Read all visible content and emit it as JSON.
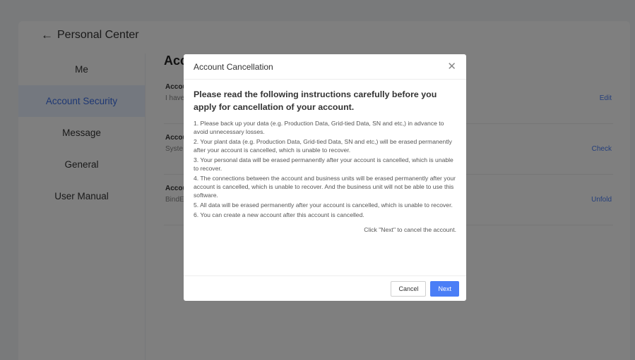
{
  "header": {
    "back_label": "Personal Center"
  },
  "sidebar": {
    "items": [
      {
        "label": "Me",
        "active": false
      },
      {
        "label": "Account Security",
        "active": true
      },
      {
        "label": "Message",
        "active": false
      },
      {
        "label": "General",
        "active": false
      },
      {
        "label": "User Manual",
        "active": false
      }
    ]
  },
  "main": {
    "title": "Acc",
    "rows": [
      {
        "label": "Accou",
        "sub": "I have",
        "action": "Edit"
      },
      {
        "label": "Accou",
        "sub": "Syste",
        "action": "Check"
      },
      {
        "label": "Accou",
        "sub": "BindE",
        "action": "Unfold"
      }
    ]
  },
  "modal": {
    "title": "Account Cancellation",
    "lead": "Please read the following instructions carefully before you apply for cancellation of your account.",
    "items": [
      "1. Please back up your data (e.g. Production Data, Grid-tied Data, SN and etc,) in advance to avoid unnecessary losses.",
      "2. Your plant data (e.g. Production Data, Grid-tied Data, SN and etc,) will be erased permanently after your account is cancelled, which is unable to recover.",
      "3. Your personal data will be erased permanently after your account is cancelled, which is unable to recover.",
      "4. The connections between the account and business units will be erased permanently after your account is cancelled, which is unable to recover. And the business unit will not be able to use this software.",
      "5. All data will be erased permanently after your account is cancelled, which is unable to recover.",
      "6. You can create a new account after this account is cancelled."
    ],
    "hint": "Click \"Next\" to cancel the account.",
    "cancel_label": "Cancel",
    "next_label": "Next"
  },
  "colors": {
    "accent": "#4a7ef6",
    "active_bg": "#e8f0ff"
  }
}
